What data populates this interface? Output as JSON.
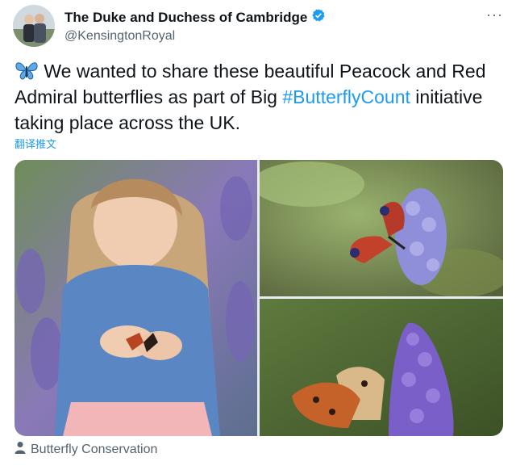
{
  "author": {
    "display_name": "The Duke and Duchess of Cambridge",
    "handle": "@KensingtonRoyal",
    "verified_icon": "verified-badge-icon",
    "verified_color": "#1d9bf0"
  },
  "more_label": "···",
  "tweet": {
    "text_before": "We wanted to share these beautiful Peacock and Red Admiral butterflies as part of Big ",
    "hashtag": "#ButterflyCount",
    "text_after": " initiative taking place across the UK.",
    "emoji_icon": "butterfly-emoji-icon"
  },
  "translate_label": "翻译推文",
  "media": {
    "photos": [
      {
        "subject": "child-holding-butterfly-photo"
      },
      {
        "subject": "peacock-butterfly-on-buddleia-photo"
      },
      {
        "subject": "butterfly-on-purple-flower-photo"
      }
    ]
  },
  "tagged": {
    "icon": "person-icon",
    "label": "Butterfly Conservation"
  },
  "colors": {
    "link": "#1d9bf0",
    "secondary_text": "#536471",
    "primary_text": "#0f1419"
  }
}
